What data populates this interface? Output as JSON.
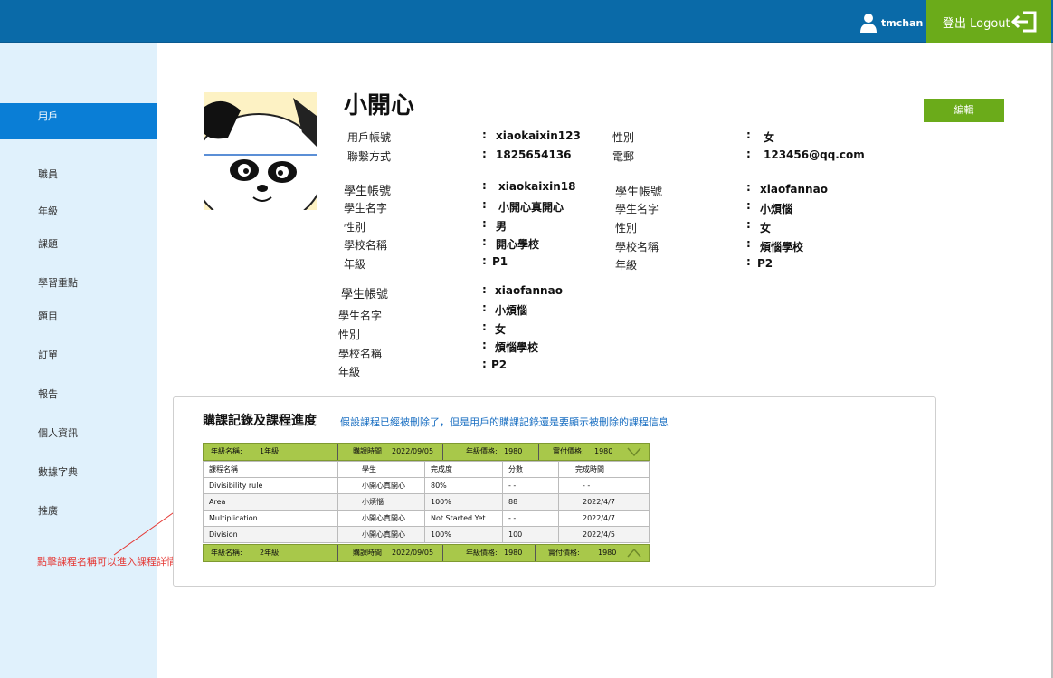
{
  "header": {
    "username": "tmchan",
    "logout_label": "登出 Logout"
  },
  "sidebar": {
    "items": [
      {
        "label": "用戶",
        "active": true
      },
      {
        "label": "職員"
      },
      {
        "label": "年級"
      },
      {
        "label": "課題"
      },
      {
        "label": "學習重點"
      },
      {
        "label": "題目"
      },
      {
        "label": "訂單"
      },
      {
        "label": "報告"
      },
      {
        "label": "個人資訊"
      },
      {
        "label": "數據字典"
      },
      {
        "label": "推廣"
      }
    ],
    "annotation": "點擊課程名稱可以進入課程詳情"
  },
  "profile": {
    "name": "小開心",
    "edit_label": "編輯",
    "fields": {
      "account_label": "用戶帳號",
      "account": "xiaokaixin123",
      "gender_label": "性別",
      "gender": "女",
      "contact_label": "聯繫方式",
      "contact": "1825654136",
      "email_label": "電郵",
      "email": "123456@qq.com"
    },
    "student_labels": {
      "account": "學生帳號",
      "name": "學生名字",
      "gender": "性別",
      "school": "學校名稱",
      "grade": "年級"
    },
    "students": [
      {
        "account": "xiaokaixin18",
        "name": "小開心真開心",
        "gender": "男",
        "school": "開心學校",
        "grade": "P1"
      },
      {
        "account": "xiaofannao",
        "name": "小煩惱",
        "gender": "女",
        "school": "煩惱學校",
        "grade": "P2"
      },
      {
        "account": "xiaofannao",
        "name": "小煩惱",
        "gender": "女",
        "school": "煩惱學校",
        "grade": "P2"
      }
    ]
  },
  "courses": {
    "title": "購課記錄及課程進度",
    "note": "假設課程已經被刪除了，但是用戶的購課記錄還是要顯示被刪除的課程信息",
    "grades": [
      {
        "grade_label": "年級名稱:",
        "grade": "1年級",
        "time_label": "購課時間",
        "time": "2022/09/05",
        "price_label": "年級價格:",
        "price": "1980",
        "paid_label": "實付價格:",
        "paid": "1980"
      },
      {
        "grade_label": "年級名稱:",
        "grade": "2年級",
        "time_label": "購課時間",
        "time": "2022/09/05",
        "price_label": "年級價格:",
        "price": "1980",
        "paid_label": "實付價格:",
        "paid": "1980"
      }
    ],
    "columns": [
      "課程名稱",
      "學生",
      "完成度",
      "分數",
      "完成時間"
    ],
    "rows": [
      [
        "Divisibility rule",
        "小開心真開心",
        "80%",
        "- -",
        "- -"
      ],
      [
        "Area",
        "小煩惱",
        "100%",
        "88",
        "2022/4/7"
      ],
      [
        "Multiplication",
        "小開心真開心",
        "Not Started Yet",
        "- -",
        "2022/4/7"
      ],
      [
        "Division",
        "小開心真開心",
        "100%",
        "100",
        "2022/4/5"
      ]
    ]
  },
  "colors": {
    "topbar": "#0a6aa8",
    "accent_green": "#6bab1a",
    "sidebar_bg": "#e0f1fc",
    "sidebar_active": "#0a7ed6",
    "grade_bar": "#a8c84a",
    "annotation_red": "#e53935",
    "note_blue": "#1a6fc2"
  }
}
